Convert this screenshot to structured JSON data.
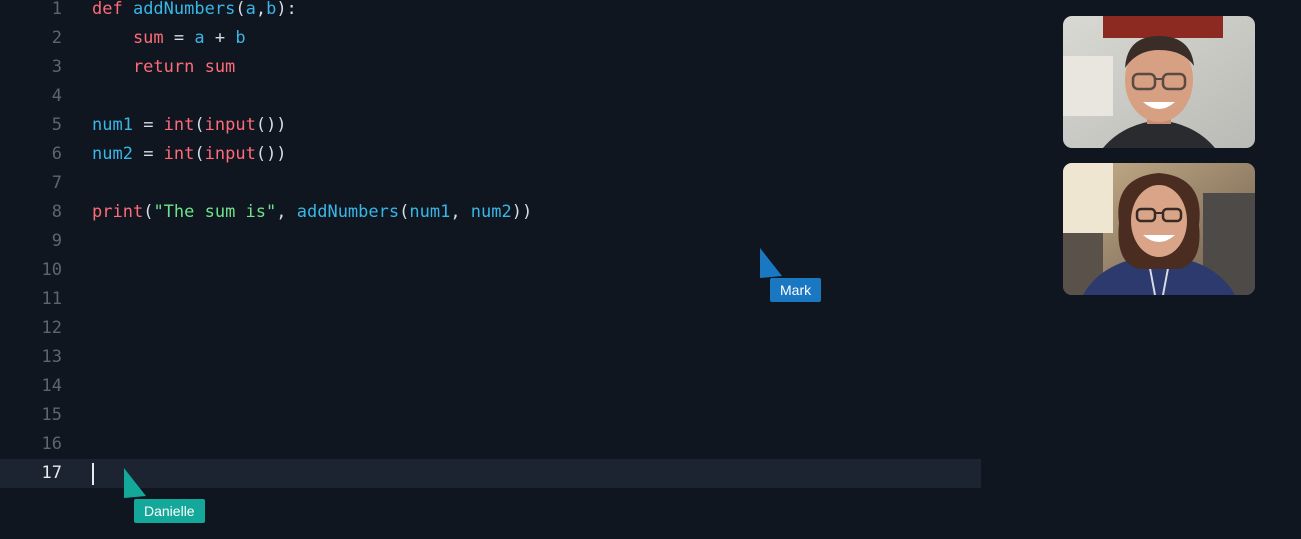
{
  "editor": {
    "lines": [
      {
        "num": "1",
        "tokens": [
          {
            "t": "def ",
            "c": "kw"
          },
          {
            "t": "addNumbers",
            "c": "fn"
          },
          {
            "t": "(",
            "c": "pn"
          },
          {
            "t": "a",
            "c": "fn"
          },
          {
            "t": ",",
            "c": "pn"
          },
          {
            "t": "b",
            "c": "fn"
          },
          {
            "t": "):",
            "c": "pn"
          }
        ]
      },
      {
        "num": "2",
        "tokens": [
          {
            "t": "    sum ",
            "c": "kw"
          },
          {
            "t": "= ",
            "c": "pn"
          },
          {
            "t": "a ",
            "c": "fn"
          },
          {
            "t": "+ ",
            "c": "pn"
          },
          {
            "t": "b",
            "c": "fn"
          }
        ]
      },
      {
        "num": "3",
        "tokens": [
          {
            "t": "    return sum",
            "c": "kw"
          }
        ]
      },
      {
        "num": "4",
        "tokens": []
      },
      {
        "num": "5",
        "tokens": [
          {
            "t": "num1 ",
            "c": "fn"
          },
          {
            "t": "= ",
            "c": "pn"
          },
          {
            "t": "int",
            "c": "kw"
          },
          {
            "t": "(",
            "c": "pn"
          },
          {
            "t": "input",
            "c": "kw"
          },
          {
            "t": "())",
            "c": "pn"
          }
        ]
      },
      {
        "num": "6",
        "tokens": [
          {
            "t": "num2 ",
            "c": "fn"
          },
          {
            "t": "= ",
            "c": "pn"
          },
          {
            "t": "int",
            "c": "kw"
          },
          {
            "t": "(",
            "c": "pn"
          },
          {
            "t": "input",
            "c": "kw"
          },
          {
            "t": "())",
            "c": "pn"
          }
        ]
      },
      {
        "num": "7",
        "tokens": []
      },
      {
        "num": "8",
        "tokens": [
          {
            "t": "print",
            "c": "kw"
          },
          {
            "t": "(",
            "c": "pn"
          },
          {
            "t": "\"The sum is\"",
            "c": "str"
          },
          {
            "t": ", ",
            "c": "pn"
          },
          {
            "t": "addNumbers",
            "c": "fn"
          },
          {
            "t": "(",
            "c": "pn"
          },
          {
            "t": "num1",
            "c": "fn"
          },
          {
            "t": ", ",
            "c": "pn"
          },
          {
            "t": "num2",
            "c": "fn"
          },
          {
            "t": "))",
            "c": "pn"
          }
        ]
      },
      {
        "num": "9",
        "tokens": []
      },
      {
        "num": "10",
        "tokens": []
      },
      {
        "num": "11",
        "tokens": []
      },
      {
        "num": "12",
        "tokens": []
      },
      {
        "num": "13",
        "tokens": []
      },
      {
        "num": "14",
        "tokens": []
      },
      {
        "num": "15",
        "tokens": []
      },
      {
        "num": "16",
        "tokens": []
      },
      {
        "num": "17",
        "tokens": [],
        "active": true
      }
    ]
  },
  "collaborators": [
    {
      "name": "Mark",
      "color": "#1a78c2",
      "icon": "pointer-cursor-icon"
    },
    {
      "name": "Danielle",
      "color": "#14a89a",
      "icon": "pointer-cursor-icon"
    }
  ],
  "video_tiles": [
    {
      "participant": "man-with-glasses",
      "icon": "webcam-video-feed"
    },
    {
      "participant": "woman-with-glasses",
      "icon": "webcam-video-feed"
    }
  ]
}
